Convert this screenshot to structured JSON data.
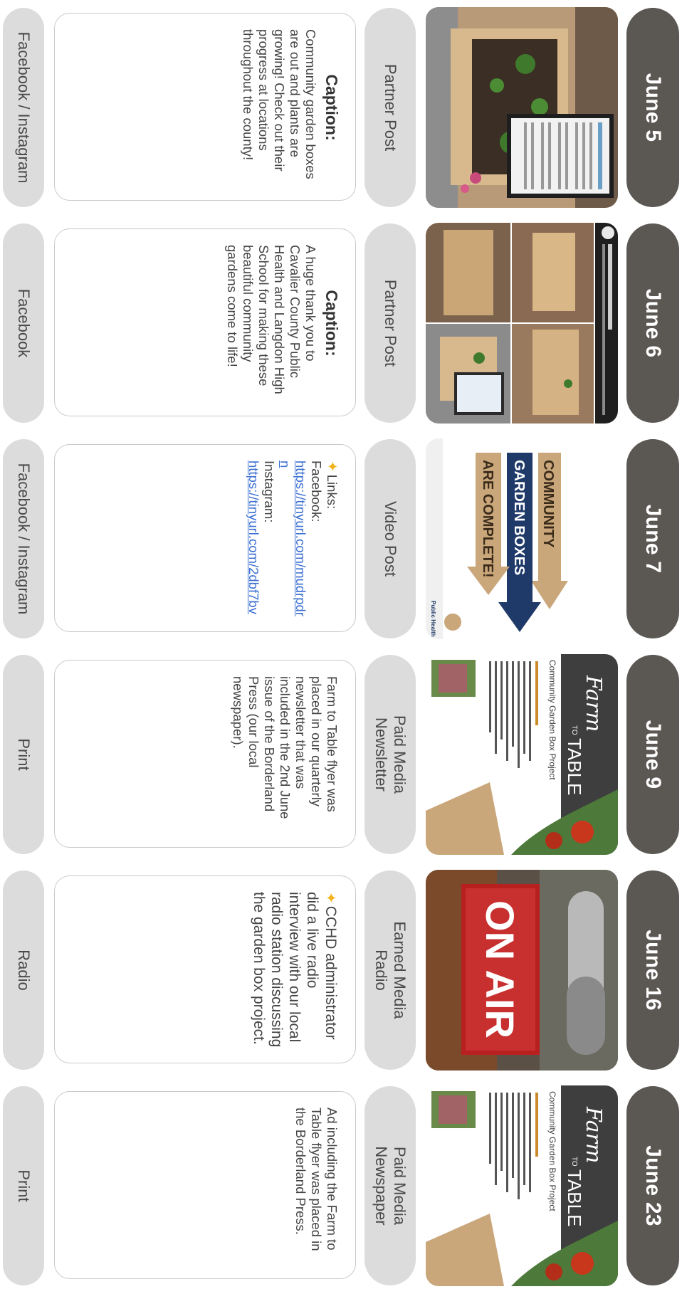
{
  "posts": [
    {
      "date": "June 5",
      "type_line1": "Partner Post",
      "type_line2": "",
      "caption_heading": "Caption:",
      "caption": "Community garden boxes are out and plants are growing! Check out their progress at locations throughout the county!",
      "platform": "Facebook / Instagram"
    },
    {
      "date": "June 6",
      "type_line1": "Partner Post",
      "type_line2": "",
      "caption_heading": "Caption:",
      "caption": "A huge thank you to Cavalier County Public Health and Langdon High School for making these beautiful community gardens come to life!",
      "platform": "Facebook"
    },
    {
      "date": "June 7",
      "type_line1": "Video Post",
      "type_line2": "",
      "links_label": "Links:",
      "facebook_label": "Facebook:",
      "facebook_link": "https://tinyurl.com/mudrpdrn",
      "instagram_label": "Instagram:",
      "instagram_link": "https://tinyurl.com/2dbf7bv",
      "thumb_text_1": "COMMUNITY",
      "thumb_text_2": "GARDEN BOXES",
      "thumb_text_3": "ARE COMPLETE!",
      "thumb_logo_text": "Public Health",
      "platform": "Facebook / Instagram"
    },
    {
      "date": "June 9",
      "type_line1": "Paid Media",
      "type_line2": "Newsletter",
      "caption": "Farm to Table flyer was placed in our quarterly newsletter that was included in the 2nd June issue of the Borderland Press (our local newspaper).",
      "thumb_script": "Farm",
      "thumb_to": "TO",
      "thumb_table": "TABLE",
      "thumb_sub": "Community Garden Box Project",
      "platform": "Print"
    },
    {
      "date": "June 16",
      "type_line1": "Earned Media",
      "type_line2": "Radio",
      "caption": "CCHD administrator did a live radio interview with our local radio station discussing the garden box project.",
      "thumb_sign": "ON AIR",
      "platform": "Radio"
    },
    {
      "date": "June 23",
      "type_line1": "Paid Media",
      "type_line2": "Newspaper",
      "caption": "Ad including the Farm to Table flyer was placed in the Borderland Press.",
      "thumb_script": "Farm",
      "thumb_to": "TO",
      "thumb_table": "TABLE",
      "thumb_sub": "Community Garden Box Project",
      "platform": "Print"
    }
  ],
  "colors": {
    "date_pill": "#5b5753",
    "type_pill": "#dcdcdc",
    "link": "#3b6fd2",
    "sparkle": "#f2b31c"
  }
}
